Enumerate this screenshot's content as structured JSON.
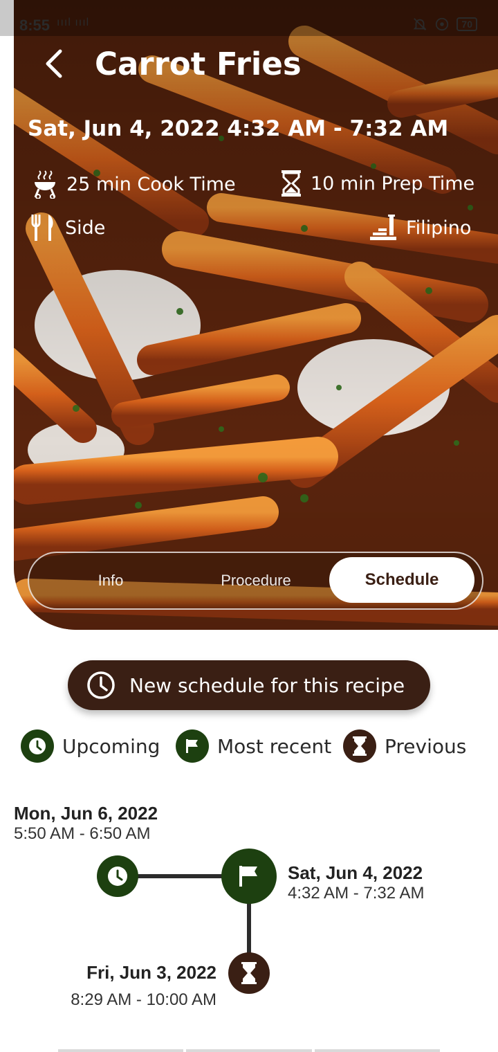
{
  "status_bar": {
    "time": "8:55",
    "signal": "ıııl ıııl",
    "battery": "70"
  },
  "header": {
    "title": "Carrot Fries",
    "datetime": "Sat, Jun 4, 2022 4:32 AM - 7:32 AM"
  },
  "meta": {
    "cook_time": "25 min Cook Time",
    "prep_time": "10 min Prep Time",
    "course": "Side",
    "cuisine": "Filipino"
  },
  "tabs": [
    {
      "label": "Info",
      "active": false
    },
    {
      "label": "Procedure",
      "active": false
    },
    {
      "label": "Schedule",
      "active": true
    }
  ],
  "actions": {
    "new_schedule_label": "New schedule for this recipe"
  },
  "legend": {
    "upcoming": "Upcoming",
    "most_recent": "Most recent",
    "previous": "Previous"
  },
  "schedule": {
    "upcoming": {
      "date": "Mon, Jun 6, 2022",
      "time": "5:50 AM - 6:50 AM"
    },
    "most_recent": {
      "date": "Sat, Jun 4, 2022",
      "time": "4:32 AM - 7:32 AM"
    },
    "previous": {
      "date": "Fri, Jun 3, 2022",
      "time": "8:29 AM - 10:00 AM"
    }
  },
  "colors": {
    "brown": "#3a1f14",
    "green": "#1d4010",
    "white": "#ffffff"
  },
  "icons": {
    "back": "back-arrow-icon",
    "grill": "grill-icon",
    "hourglass": "hourglass-icon",
    "utensils": "utensils-icon",
    "cuisine": "cuisine-icon",
    "clock": "clock-icon",
    "flag": "flag-icon"
  }
}
